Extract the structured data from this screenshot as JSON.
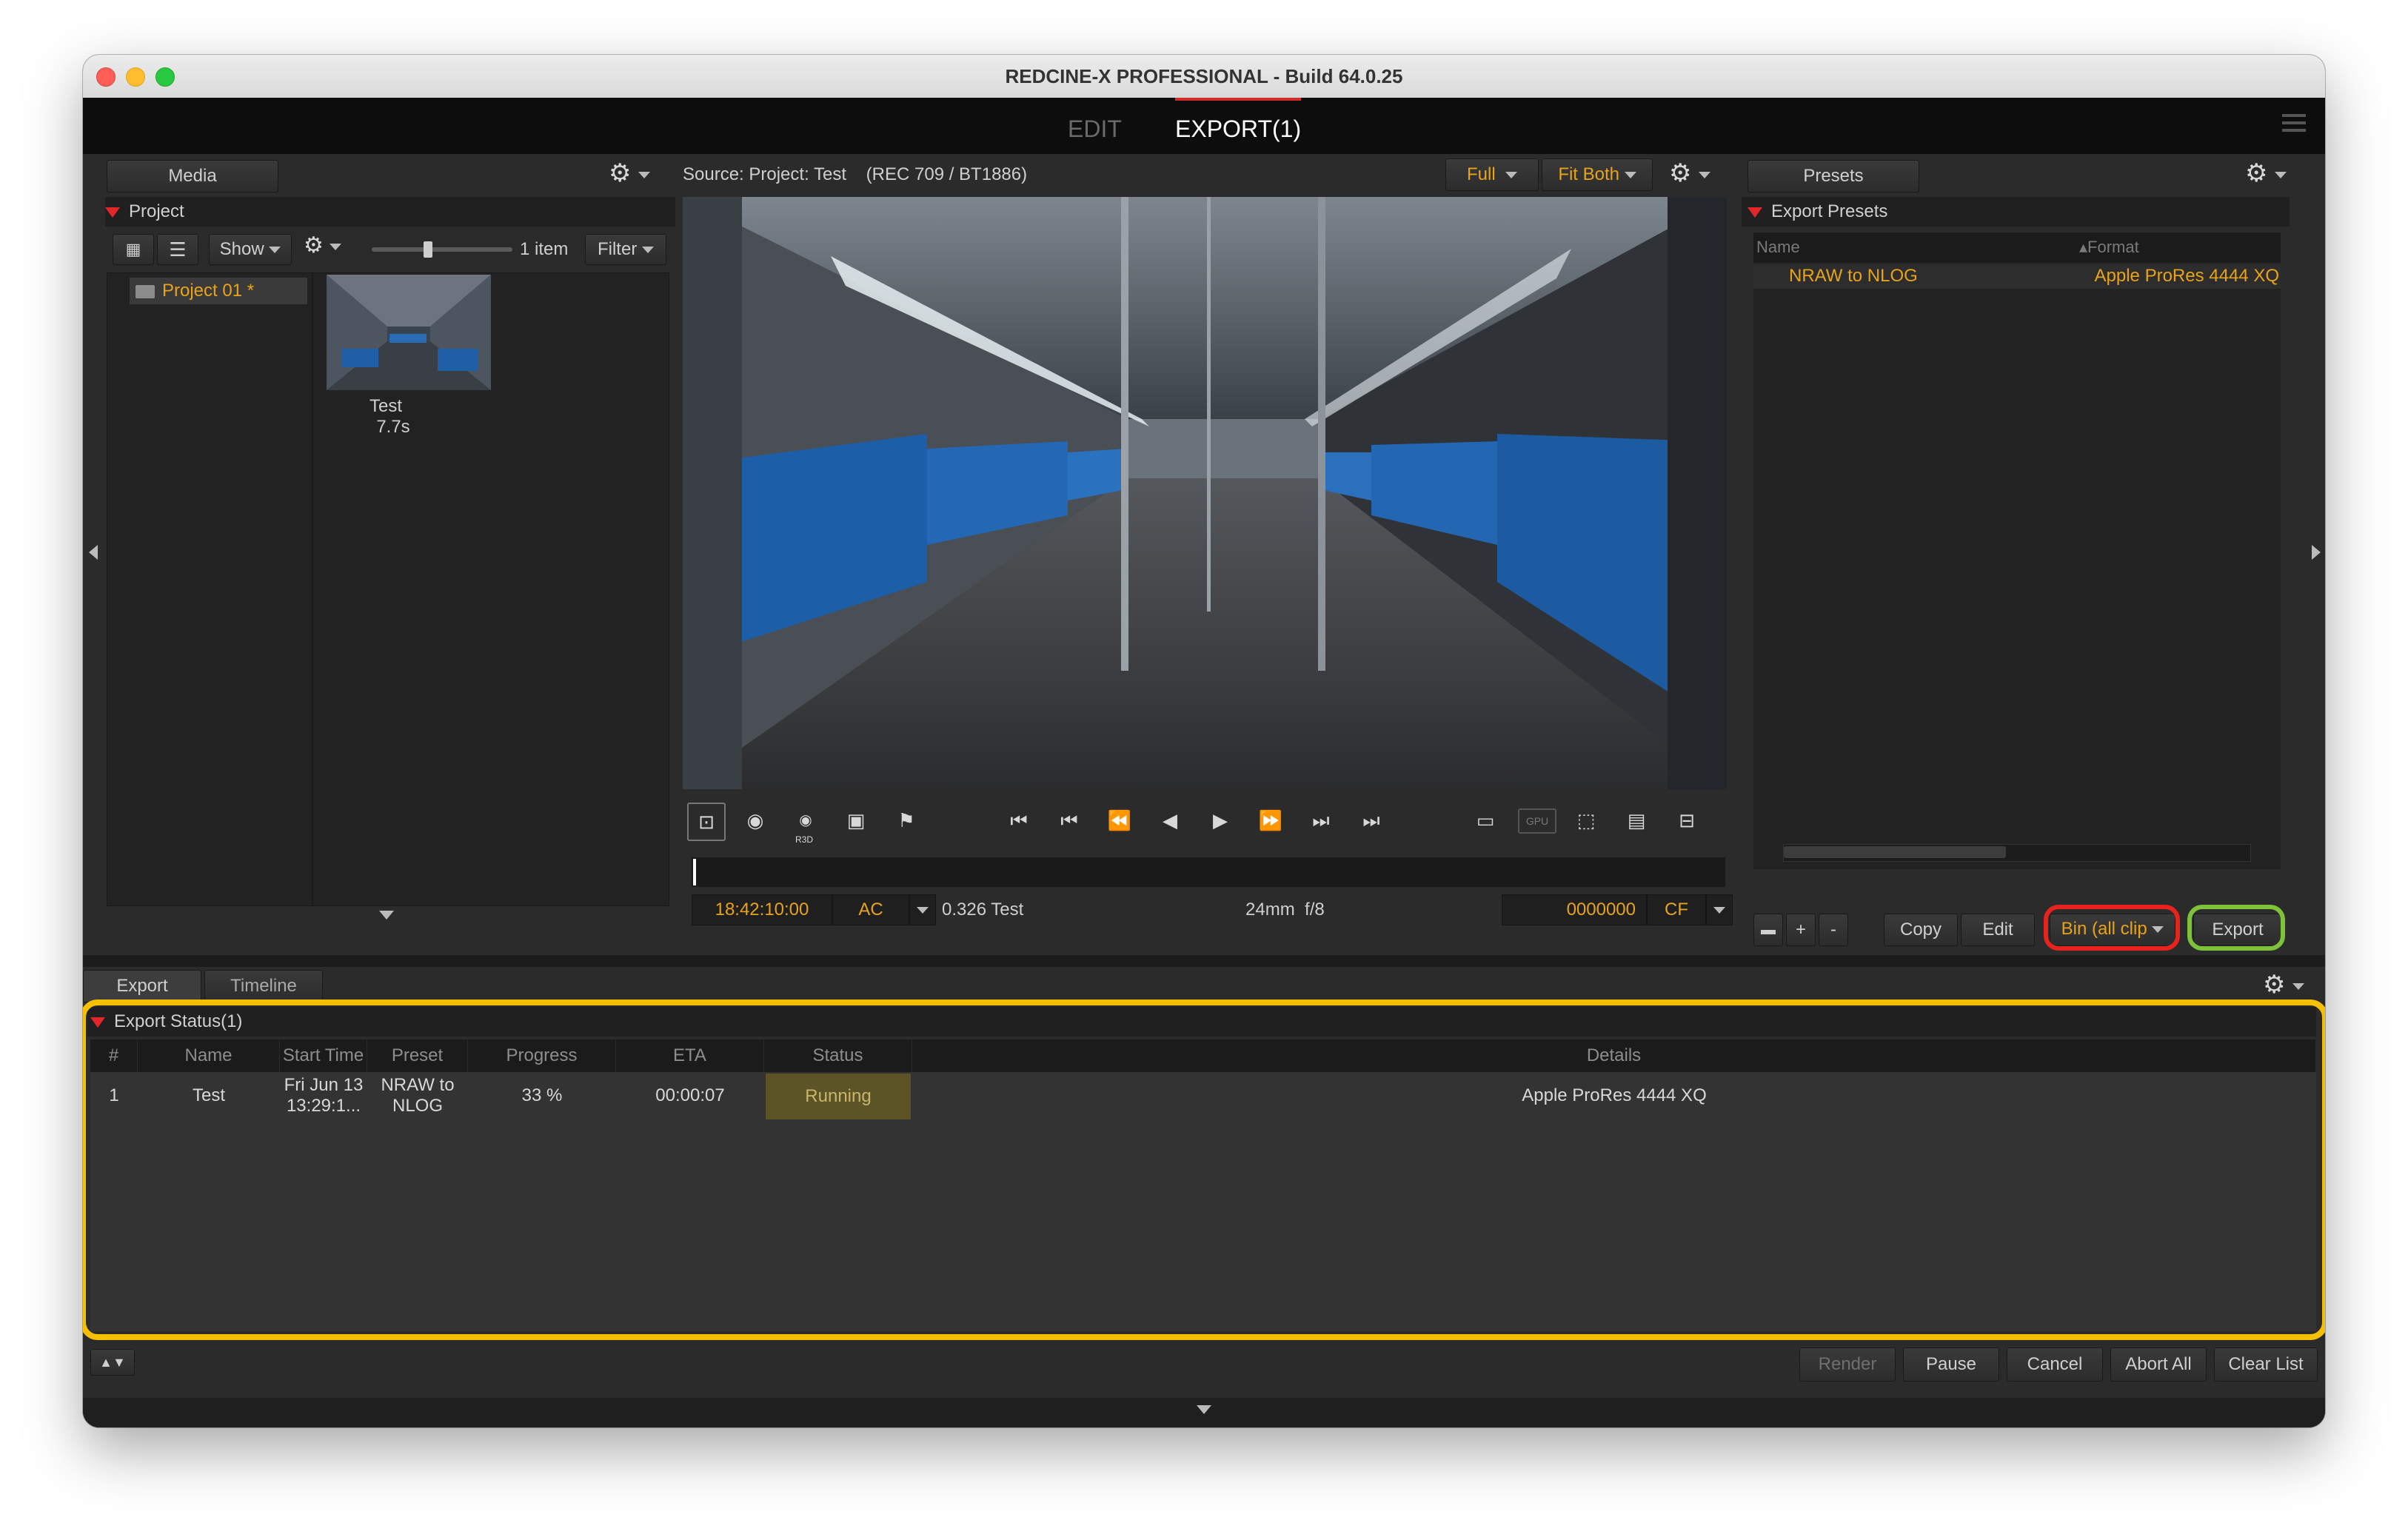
{
  "window": {
    "title": "REDCINE-X PROFESSIONAL - Build 64.0.25",
    "mode_tabs": [
      "EDIT",
      "EXPORT(1)"
    ]
  },
  "media_panel": {
    "tab": "Media",
    "section": "Project",
    "toolbar": {
      "show_label": "Show",
      "item_count": "1 item",
      "filter_label": "Filter"
    },
    "tree_item": "Project 01 *",
    "clip": {
      "name": "Test",
      "duration": "7.7s"
    }
  },
  "viewer": {
    "source_label": "Source: Project: Test",
    "color_space": "(REC 709 / BT1886)",
    "quality": "Full",
    "fit": "Fit Both",
    "timecode": "18:42:10:00",
    "tc_mode": "AC",
    "clip_info": "0.326 Test",
    "lens": "24mm",
    "aperture": "f/8",
    "frame": "0000000",
    "frame_mode": "CF",
    "icon_labels": {
      "r3d": "R3D",
      "gpu": "GPU"
    }
  },
  "presets_panel": {
    "tab": "Presets",
    "section": "Export Presets",
    "columns": {
      "name": "Name",
      "format": "Format"
    },
    "rows": [
      {
        "name": "NRAW to NLOG",
        "format": "Apple ProRes 4444 XQ"
      }
    ],
    "buttons": {
      "plus": "+",
      "minus": "-",
      "copy": "Copy",
      "edit": "Edit",
      "bin": "Bin (all clip",
      "export": "Export"
    }
  },
  "bottom_tabs": [
    "Export",
    "Timeline"
  ],
  "export_status": {
    "section": "Export Status(1)",
    "columns": [
      "#",
      "Name",
      "Start Time",
      "Preset",
      "Progress",
      "ETA",
      "Status",
      "Details"
    ],
    "rows": [
      {
        "index": "1",
        "name": "Test",
        "start_time_line1": "Fri Jun 13",
        "start_time_line2": "13:29:1...",
        "preset_line1": "NRAW to",
        "preset_line2": "NLOG",
        "progress": "33 %",
        "eta": "00:00:07",
        "status": "Running",
        "details": "Apple ProRes 4444 XQ"
      }
    ]
  },
  "queue_buttons": {
    "render": "Render",
    "pause": "Pause",
    "cancel": "Cancel",
    "abort_all": "Abort All",
    "clear_list": "Clear List"
  },
  "colors": {
    "accent_orange": "#e8a317",
    "highlight_red": "#e6231c",
    "highlight_green": "#7ec23a",
    "highlight_yellow": "#f5c000"
  }
}
